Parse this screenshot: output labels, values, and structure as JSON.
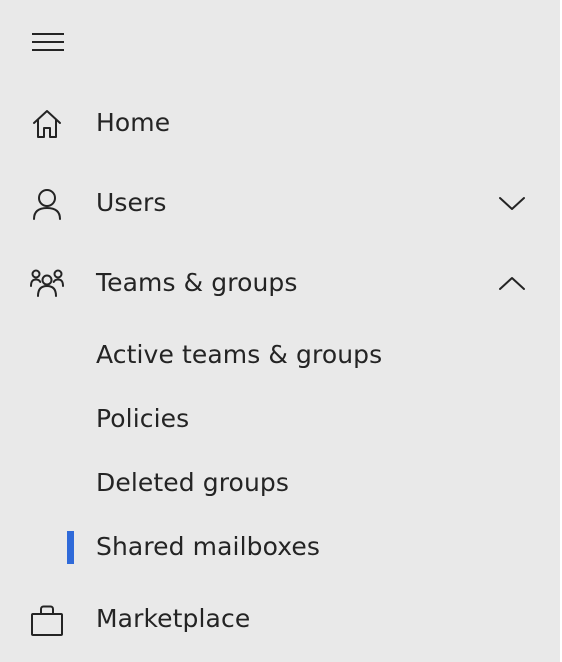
{
  "nav": {
    "menu_icon": "hamburger-icon",
    "items": [
      {
        "label": "Home",
        "icon": "home-icon"
      },
      {
        "label": "Users",
        "icon": "person-icon",
        "chevron": "chevron-down-icon",
        "expanded": false
      },
      {
        "label": "Teams & groups",
        "icon": "people-group-icon",
        "chevron": "chevron-up-icon",
        "expanded": true
      },
      {
        "label": "Marketplace",
        "icon": "shopping-bag-icon"
      }
    ],
    "sub_items": [
      {
        "label": "Active teams & groups",
        "selected": false
      },
      {
        "label": "Policies",
        "selected": false
      },
      {
        "label": "Deleted groups",
        "selected": false
      },
      {
        "label": "Shared mailboxes",
        "selected": true
      }
    ]
  },
  "colors": {
    "background": "#e9e9e9",
    "text": "#242424",
    "accent": "#2f6ad9"
  }
}
